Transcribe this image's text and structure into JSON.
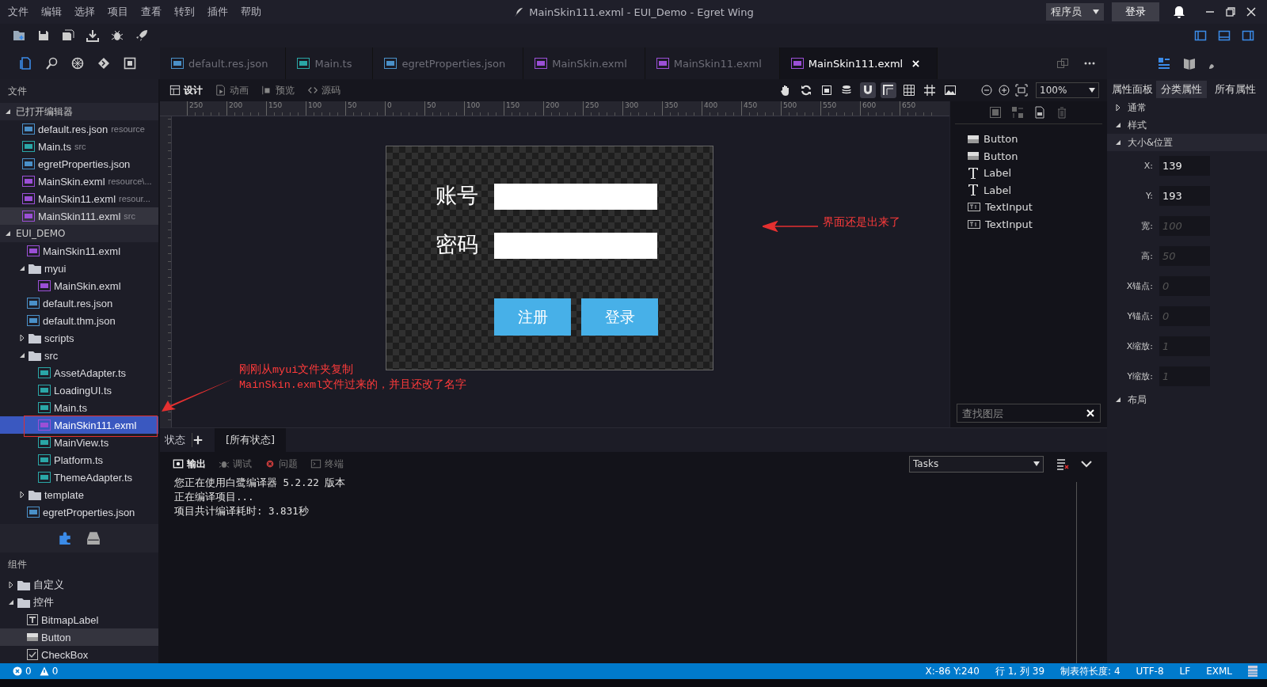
{
  "menu": [
    "文件",
    "编辑",
    "选择",
    "项目",
    "查看",
    "转到",
    "插件",
    "帮助"
  ],
  "title": "MainSkin111.exml - EUI_Demo - Egret Wing",
  "role_select": {
    "value": "程序员"
  },
  "login_button": "登录",
  "activity_bar": [
    {
      "kind": "files",
      "selected": true
    },
    {
      "kind": "search",
      "selected": false
    },
    {
      "kind": "debug",
      "selected": false
    },
    {
      "kind": "git",
      "selected": false
    },
    {
      "kind": "extensions",
      "selected": false
    }
  ],
  "editor_tabs": [
    {
      "label": "default.res.json",
      "kind": "json",
      "selected": false
    },
    {
      "label": "Main.ts",
      "kind": "ts",
      "selected": false
    },
    {
      "label": "egretProperties.json",
      "kind": "json",
      "selected": false
    },
    {
      "label": "MainSkin.exml",
      "kind": "exml",
      "selected": false
    },
    {
      "label": "MainSkin11.exml",
      "kind": "exml",
      "selected": false
    },
    {
      "label": "MainSkin111.exml",
      "kind": "exml",
      "selected": true
    }
  ],
  "sidebar": {
    "title": "文件",
    "open_editors": {
      "title": "已打开编辑器",
      "expanded": true,
      "items": [
        {
          "name": "default.res.json",
          "hint": "resource",
          "kind": "json",
          "selected": false
        },
        {
          "name": "Main.ts",
          "hint": "src",
          "kind": "ts",
          "selected": false
        },
        {
          "name": "egretProperties.json",
          "kind": "json",
          "selected": false
        },
        {
          "name": "MainSkin.exml",
          "hint": "resource\\...",
          "kind": "exml",
          "selected": false
        },
        {
          "name": "MainSkin11.exml",
          "hint": "resour...",
          "kind": "exml",
          "selected": false
        },
        {
          "name": "MainSkin111.exml",
          "hint": "src",
          "kind": "exml",
          "selected": true
        }
      ]
    },
    "project": {
      "title": "EUI_DEMO",
      "expanded": true,
      "children": [
        {
          "name": "MainSkin11.exml",
          "kind": "exml",
          "selected": false
        },
        {
          "name": "myui",
          "kind": "folder",
          "expanded": true,
          "selected": false,
          "children": [
            {
              "name": "MainSkin.exml",
              "kind": "exml",
              "selected": false
            }
          ]
        },
        {
          "name": "default.res.json",
          "kind": "json",
          "selected": false
        },
        {
          "name": "default.thm.json",
          "kind": "json",
          "selected": false
        },
        {
          "name": "scripts",
          "kind": "folder",
          "expanded": false,
          "selected": false
        },
        {
          "name": "src",
          "kind": "folder",
          "expanded": true,
          "selected": false,
          "children": [
            {
              "name": "AssetAdapter.ts",
              "kind": "ts",
              "selected": false
            },
            {
              "name": "LoadingUI.ts",
              "kind": "ts",
              "selected": false
            },
            {
              "name": "Main.ts",
              "kind": "ts",
              "selected": false
            },
            {
              "name": "MainSkin111.exml",
              "kind": "exml",
              "selected": true
            },
            {
              "name": "MainView.ts",
              "kind": "ts",
              "selected": false
            },
            {
              "name": "Platform.ts",
              "kind": "ts",
              "selected": false
            },
            {
              "name": "ThemeAdapter.ts",
              "kind": "ts",
              "selected": false
            }
          ]
        },
        {
          "name": "template",
          "kind": "folder",
          "expanded": false,
          "selected": false
        },
        {
          "name": "egretProperties.json",
          "kind": "json",
          "selected": false
        }
      ]
    },
    "components": {
      "title": "组件",
      "children": [
        {
          "name": "自定义",
          "kind": "folder",
          "expanded": false,
          "selected": false
        },
        {
          "name": "控件",
          "kind": "folder",
          "expanded": true,
          "selected": false,
          "children": [
            {
              "name": "BitmapLabel",
              "kind": "label",
              "selected": false
            },
            {
              "name": "Button",
              "kind": "button",
              "selected": true
            },
            {
              "name": "CheckBox",
              "kind": "checkbox",
              "selected": false
            }
          ]
        }
      ]
    }
  },
  "design_toolbar": {
    "modes": [
      {
        "label": "设计",
        "kind": "design",
        "selected": true
      },
      {
        "label": "动画",
        "kind": "animation",
        "selected": false
      },
      {
        "label": "预览",
        "kind": "preview",
        "selected": false
      },
      {
        "label": "源码",
        "kind": "source",
        "selected": false
      }
    ],
    "toggles": [
      {
        "kind": "hand",
        "on": false
      },
      {
        "kind": "refresh",
        "on": false
      },
      {
        "kind": "fit",
        "on": false
      },
      {
        "kind": "layers",
        "on": false
      },
      {
        "kind": "magnet",
        "on": true
      },
      {
        "kind": "corner",
        "on": true
      },
      {
        "kind": "grid",
        "on": false
      },
      {
        "kind": "hash",
        "on": false
      },
      {
        "kind": "image",
        "on": false
      }
    ],
    "zoom": "100%"
  },
  "ruler": {
    "ticks": [
      "250",
      "200",
      "150",
      "100",
      "50",
      "0",
      "50",
      "100",
      "150",
      "200",
      "250",
      "300",
      "350",
      "400",
      "450",
      "500",
      "550",
      "600",
      "650"
    ]
  },
  "design": {
    "fields": [
      {
        "label": "账号"
      },
      {
        "label": "密码"
      }
    ],
    "buttons": [
      "注册",
      "登录"
    ]
  },
  "annotations": {
    "note": "界面还是出来了",
    "copy_note": [
      "刚刚从myui文件夹复制",
      "MainSkin.exml文件过来的，并且还改了名字"
    ]
  },
  "layers": {
    "items": [
      {
        "name": "Button",
        "kind": "button"
      },
      {
        "name": "Button",
        "kind": "button"
      },
      {
        "name": "Label",
        "kind": "label"
      },
      {
        "name": "Label",
        "kind": "label"
      },
      {
        "name": "TextInput",
        "kind": "textinput"
      },
      {
        "name": "TextInput",
        "kind": "textinput"
      }
    ],
    "search": {
      "placeholder": "查找图层"
    }
  },
  "properties": {
    "title": "属性面板",
    "tabs": [
      {
        "label": "分类属性",
        "selected": true
      },
      {
        "label": "所有属性",
        "selected": false
      }
    ],
    "sections": [
      {
        "title": "通常",
        "expanded": false
      },
      {
        "title": "样式",
        "expanded": true
      },
      {
        "title": "大小&位置",
        "expanded": true,
        "fields": [
          {
            "label": "X:",
            "value": "139"
          },
          {
            "label": "Y:",
            "value": "193"
          },
          {
            "label": "宽:",
            "placeholder": "100"
          },
          {
            "label": "高:",
            "placeholder": "50"
          },
          {
            "label": "X锚点:",
            "placeholder": "0"
          },
          {
            "label": "Y锚点:",
            "placeholder": "0"
          },
          {
            "label": "X缩放:",
            "placeholder": "1"
          },
          {
            "label": "Y缩放:",
            "placeholder": "1"
          }
        ]
      },
      {
        "title": "布局",
        "expanded": true
      }
    ]
  },
  "states_bar": {
    "title": "状态",
    "tabs": [
      {
        "label": "[所有状态]",
        "selected": true
      }
    ]
  },
  "output": {
    "tabs": [
      {
        "label": "输出",
        "kind": "output",
        "selected": true
      },
      {
        "label": "调试",
        "kind": "debug",
        "selected": false
      },
      {
        "label": "问题",
        "kind": "problems",
        "selected": false
      },
      {
        "label": "终端",
        "kind": "terminal",
        "selected": false
      }
    ],
    "task_select": "Tasks",
    "lines": [
      "您正在使用白鹭编译器 5.2.22 版本",
      "正在编译项目...",
      "项目共计编译耗时: 3.831秒"
    ]
  },
  "status_bar": {
    "errors": "0",
    "warnings": "0",
    "items": [
      "X:-86 Y:240",
      "行 1, 列 39",
      "制表符长度: 4",
      "UTF-8",
      "LF",
      "EXML"
    ]
  }
}
